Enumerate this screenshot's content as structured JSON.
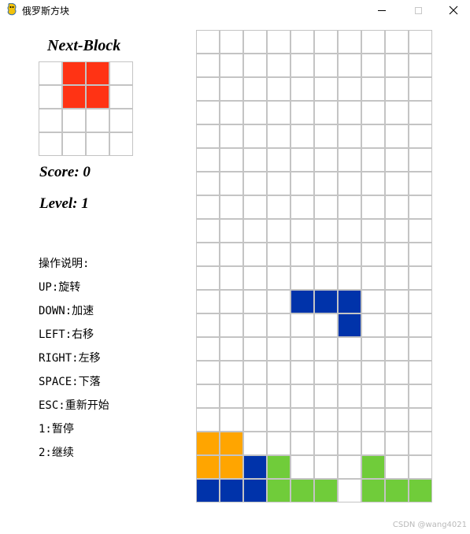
{
  "window": {
    "title": "俄罗斯方块",
    "icon": "pygame-snake-icon"
  },
  "next_block": {
    "title": "Next-Block",
    "grid": [
      [
        0,
        1,
        1,
        0
      ],
      [
        0,
        1,
        1,
        0
      ],
      [
        0,
        0,
        0,
        0
      ],
      [
        0,
        0,
        0,
        0
      ]
    ]
  },
  "score_text": "Score: 0",
  "level_text": "Level: 1",
  "instructions": [
    "操作说明:",
    "UP:旋转",
    "DOWN:加速",
    "LEFT:右移",
    "RIGHT:左移",
    "SPACE:下落",
    "ESC:重新开始",
    "1:暂停",
    "2:继续"
  ],
  "colors": {
    "1": "#ff3314",
    "2": "#0033aa",
    "3": "#ffa500",
    "4": "#70cc3a"
  },
  "board": [
    [
      0,
      0,
      0,
      0,
      0,
      0,
      0,
      0,
      0,
      0
    ],
    [
      0,
      0,
      0,
      0,
      0,
      0,
      0,
      0,
      0,
      0
    ],
    [
      0,
      0,
      0,
      0,
      0,
      0,
      0,
      0,
      0,
      0
    ],
    [
      0,
      0,
      0,
      0,
      0,
      0,
      0,
      0,
      0,
      0
    ],
    [
      0,
      0,
      0,
      0,
      0,
      0,
      0,
      0,
      0,
      0
    ],
    [
      0,
      0,
      0,
      0,
      0,
      0,
      0,
      0,
      0,
      0
    ],
    [
      0,
      0,
      0,
      0,
      0,
      0,
      0,
      0,
      0,
      0
    ],
    [
      0,
      0,
      0,
      0,
      0,
      0,
      0,
      0,
      0,
      0
    ],
    [
      0,
      0,
      0,
      0,
      0,
      0,
      0,
      0,
      0,
      0
    ],
    [
      0,
      0,
      0,
      0,
      0,
      0,
      0,
      0,
      0,
      0
    ],
    [
      0,
      0,
      0,
      0,
      0,
      0,
      0,
      0,
      0,
      0
    ],
    [
      0,
      0,
      0,
      0,
      2,
      2,
      2,
      0,
      0,
      0
    ],
    [
      0,
      0,
      0,
      0,
      0,
      0,
      2,
      0,
      0,
      0
    ],
    [
      0,
      0,
      0,
      0,
      0,
      0,
      0,
      0,
      0,
      0
    ],
    [
      0,
      0,
      0,
      0,
      0,
      0,
      0,
      0,
      0,
      0
    ],
    [
      0,
      0,
      0,
      0,
      0,
      0,
      0,
      0,
      0,
      0
    ],
    [
      0,
      0,
      0,
      0,
      0,
      0,
      0,
      0,
      0,
      0
    ],
    [
      3,
      3,
      0,
      0,
      0,
      0,
      0,
      0,
      0,
      0
    ],
    [
      3,
      3,
      2,
      4,
      0,
      0,
      0,
      4,
      0,
      0
    ],
    [
      2,
      2,
      2,
      4,
      4,
      4,
      0,
      4,
      4,
      4
    ]
  ],
  "watermark": "CSDN @wang4021"
}
